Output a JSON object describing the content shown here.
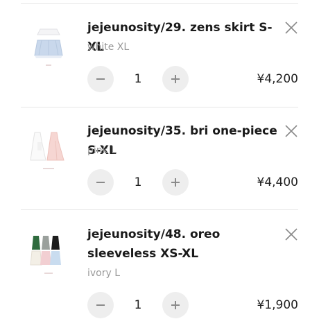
{
  "cart": {
    "items": [
      {
        "title": "jejeunosity/29. zens skirt S-XL",
        "variant": "white XL",
        "quantity": "1",
        "price": "¥4,200",
        "image": "skirt-product-image"
      },
      {
        "title": "jejeunosity/35. bri one-piece S-XL",
        "variant": "pink L",
        "quantity": "1",
        "price": "¥4,400",
        "image": "one-piece-product-image"
      },
      {
        "title": "jejeunosity/48. oreo sleeveless XS-XL",
        "variant": "ivory L",
        "quantity": "1",
        "price": "¥1,900",
        "image": "sleeveless-product-image"
      }
    ]
  },
  "icons": {
    "remove": "close-icon",
    "decrease": "minus-icon",
    "increase": "plus-icon"
  },
  "colors": {
    "button_bg": "#eeeeee",
    "muted_text": "#999999",
    "divider": "#e6e6e6"
  }
}
